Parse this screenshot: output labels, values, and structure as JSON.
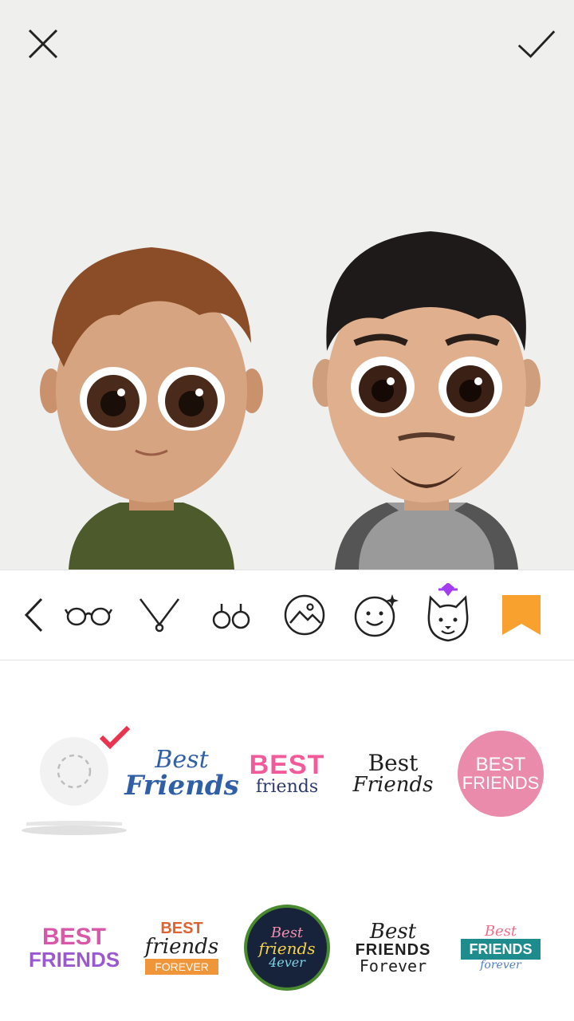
{
  "header": {
    "close_icon": "close-icon",
    "confirm_icon": "check-icon"
  },
  "toolbar": {
    "icons": [
      "back-chevron-icon",
      "glasses-icon",
      "necklace-icon",
      "earrings-icon",
      "background-icon",
      "emoji-face-icon",
      "pet-dog-icon",
      "bookmark-icon"
    ],
    "accent": "#f9a12e",
    "premium_gem_color": "#a33ef0"
  },
  "stickers": [
    {
      "id": "none"
    },
    {
      "line1": "Best",
      "line2": "Friends"
    },
    {
      "line1": "BEST",
      "line2": "friends"
    },
    {
      "line1": "Best",
      "line2": "Friends"
    },
    {
      "line1": "BEST",
      "line2": "FRIENDS"
    },
    {
      "line1": "BEST",
      "line2": "FRIENDS"
    },
    {
      "line1": "BEST",
      "line2": "friends",
      "line3": "FOREVER"
    },
    {
      "line1": "Best",
      "line2": "friends",
      "line3": "4ever"
    },
    {
      "line1": "Best",
      "line2": "FRIENDS",
      "line3": "Forever"
    },
    {
      "line1": "Best",
      "line2": "FRIENDS",
      "line3": "forever"
    }
  ],
  "colors": {
    "selected_check": "#e8344f",
    "preview_bg": "#efefed"
  }
}
